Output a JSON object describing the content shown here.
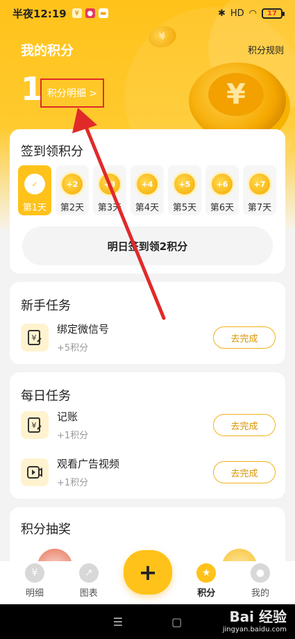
{
  "status_bar": {
    "time": "半夜12:19",
    "mini_icons": [
      "¥",
      "✉"
    ],
    "network": "HD",
    "battery": "17"
  },
  "header": {
    "title": "我的积分",
    "rules_link": "积分规则",
    "points": "1",
    "detail_link": "积分明细 >",
    "coin_symbol": "¥"
  },
  "checkin": {
    "title": "签到领积分",
    "days": [
      {
        "label": "第1天",
        "badge": "✓",
        "active": true
      },
      {
        "label": "第2天",
        "badge": "+2"
      },
      {
        "label": "第3天",
        "badge": "+3"
      },
      {
        "label": "第4天",
        "badge": "+4"
      },
      {
        "label": "第5天",
        "badge": "+5"
      },
      {
        "label": "第6天",
        "badge": "+6"
      },
      {
        "label": "第7天",
        "badge": "+7"
      }
    ],
    "button": "明日签到领2积分"
  },
  "newbie_tasks": {
    "title": "新手任务",
    "items": [
      {
        "name": "绑定微信号",
        "reward": "+5积分",
        "action": "去完成"
      }
    ]
  },
  "daily_tasks": {
    "title": "每日任务",
    "items": [
      {
        "name": "记账",
        "reward": "+1积分",
        "action": "去完成"
      },
      {
        "name": "观看广告视频",
        "reward": "+1积分",
        "action": "去完成"
      }
    ]
  },
  "lottery": {
    "title": "积分抽奖"
  },
  "tabbar": {
    "tabs": [
      {
        "label": "明细"
      },
      {
        "label": "图表"
      },
      {
        "label": "积分",
        "active": true
      },
      {
        "label": "我的"
      }
    ],
    "fab": "+"
  },
  "system_nav": {
    "menu": "☰",
    "home": "▢"
  },
  "watermark": {
    "main": "Bai 经验",
    "sub": "jingyan.baidu.com"
  },
  "colors": {
    "accent": "#ffc21a",
    "annotation": "#e02a2a"
  }
}
